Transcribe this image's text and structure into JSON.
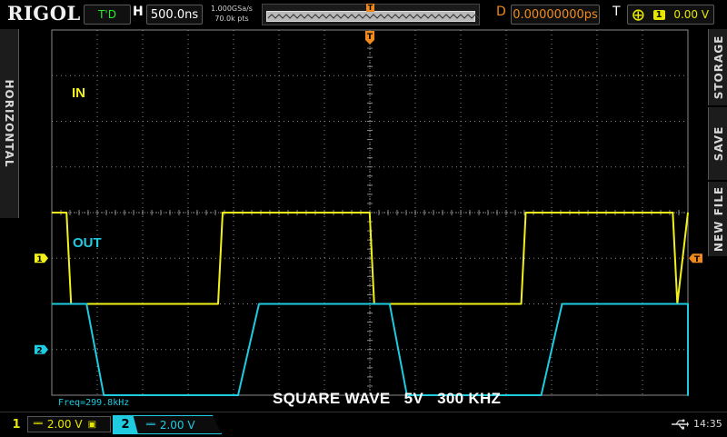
{
  "header": {
    "brand": "RIGOL",
    "run_status": "T'D",
    "timebase_label": "H",
    "timebase": "500.0ns",
    "sample_rate": "1.000GSa/s",
    "memory_depth": "70.0k pts",
    "delay_label": "D",
    "delay": "0.00000000ps",
    "trigger_label": "T",
    "trigger_source": "1",
    "trigger_level": "0.00 V"
  },
  "side_tabs": {
    "left": "HORIZONTAL",
    "storage": "STORAGE",
    "save": "SAVE",
    "new_file": "NEW FILE"
  },
  "channels": [
    {
      "number": "1",
      "label": "IN",
      "scale": "2.00 V",
      "coupling": "DC",
      "color": "#f2f21a",
      "marker": "1",
      "offset_div": -1.0,
      "high_div": 1.0,
      "low_div": -1.0
    },
    {
      "number": "2",
      "label": "OUT",
      "scale": "2.00 V",
      "coupling": "DC",
      "color": "#1ecbe1",
      "marker": "2",
      "offset_div": -3.0,
      "high_div": 1.0,
      "low_div": -1.0
    }
  ],
  "screen": {
    "frequency_readout": "Freq=299.8kHz",
    "caption": "SQUARE WAVE   5V   300 KHZ",
    "trigger_marker": "T"
  },
  "status": {
    "time": "14:35"
  },
  "colors": {
    "grid": "#8a8a8a",
    "trigger": "#f08a1c",
    "ch1": "#f2f21a",
    "ch2": "#1ecbe1"
  }
}
